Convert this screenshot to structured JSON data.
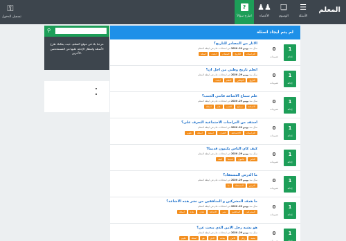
{
  "header": {
    "brand": "المعلم",
    "nav": [
      {
        "label": "الأسئلة",
        "icon": "list-icon"
      },
      {
        "label": "الوسوم",
        "icon": "tags-icon"
      },
      {
        "label": "الأعضاء",
        "icon": "users-icon"
      },
      {
        "label": "اطرح سؤالاً",
        "icon": "question-icon"
      }
    ],
    "login_label": "تسجيل الدخول"
  },
  "main": {
    "heading": "لم يتم ايجاد اسئلة",
    "questions": [
      {
        "title": "الاثار من المصادر للتاريخ؟",
        "votes": "1",
        "votes_label": "إجابة",
        "answers": "0",
        "answers_label": "تصويتات",
        "meta_prefix": "سأل منذ",
        "date": "يونيو 29، 2020",
        "meta_suffix": "في امتحانات عام في ابيطة المعلم",
        "tags": [
          "الدراسات",
          "التاريخ",
          "المصادر",
          "ابحث",
          "اسئلة"
        ]
      },
      {
        "title": "اتعلم تاريخ وطني من اجل ان؟",
        "votes": "1",
        "votes_label": "إجابة",
        "answers": "0",
        "answers_label": "تصويتات",
        "meta_prefix": "سأل منذ",
        "date": "يونيو 29، 2020",
        "meta_suffix": "في امتحانات عام في ابيطة المعلم",
        "tags": [
          "التاريخ",
          "الوطني",
          "التعلم",
          "ابحث"
        ]
      },
      {
        "title": "علم سماع الاشاعة فاتني الجنب؟",
        "votes": "1",
        "votes_label": "إجابة",
        "answers": "0",
        "answers_label": "تصويتات",
        "meta_prefix": "سأل منذ",
        "date": "يونيو 29، 2020",
        "meta_suffix": "في امتحانات عام في ابيطة المعلم",
        "tags": [
          "الاشاعة",
          "سماع",
          "الجنب",
          "علم",
          "اسئلة"
        ]
      },
      {
        "title": "استفد من الدراسات الاجتماعية التعرف على؟",
        "votes": "1",
        "votes_label": "إجابة",
        "answers": "0",
        "answers_label": "تصويتات",
        "meta_prefix": "سأل منذ",
        "date": "يونيو 29، 2020",
        "meta_suffix": "في امتحانات عام في ابيطة المعلم",
        "tags": [
          "الدراسات",
          "الاجتماعية",
          "التعرف",
          "استفد",
          "اسئلة",
          "علوم"
        ]
      },
      {
        "title": "كيف كان الناس يكتبون قديما؟",
        "votes": "1",
        "votes_label": "إجابة",
        "answers": "0",
        "answers_label": "تصويتات",
        "meta_prefix": "سأل منذ",
        "date": "يونيو 29، 2020",
        "meta_suffix": "في امتحانات عام في ابيطة المعلم",
        "tags": [
          "الناس",
          "يكتبون",
          "قديما",
          "كيف"
        ]
      },
      {
        "title": "ما الدرس المستفاد؟",
        "votes": "1",
        "votes_label": "إجابة",
        "answers": "0",
        "answers_label": "تصويتات",
        "meta_prefix": "سأل منذ",
        "date": "يونيو 29، 2020",
        "meta_suffix": "في امتحانات عام في ابيطة المعلم",
        "tags": [
          "الدرس",
          "المستفاد",
          "ما"
        ]
      },
      {
        "title": "ما هدف المشركين و المنافقين من نشر هذه الاشاعة؟",
        "votes": "1",
        "votes_label": "إجابة",
        "answers": "0",
        "answers_label": "تصويتات",
        "meta_prefix": "سأل منذ",
        "date": "يونيو 29، 2020",
        "meta_suffix": "في امتحانات عام في ابيطة المعلم",
        "tags": [
          "المشركين",
          "المنافقين",
          "نشر",
          "الاشاعة",
          "هدف",
          "هذه",
          "اسئلة"
        ]
      },
      {
        "title": "هو يشبه رجل الامن الذي يبحث عن؟",
        "votes": "1",
        "votes_label": "إجابة",
        "answers": "0",
        "answers_label": "تصويتات",
        "meta_prefix": "سأل منذ",
        "date": "يونيو 29، 2020",
        "meta_suffix": "في امتحانات عام في ابيطة المعلم",
        "tags": [
          "يشبه",
          "رجل",
          "الامن",
          "يبحث",
          "الذي",
          "هو",
          "اسئلة",
          "علوم"
        ]
      }
    ]
  },
  "sidebar": {
    "search_placeholder": "",
    "welcome": "مرحبا بك في موقع المعلم، حيث يمكنك طرح الأسئلة وانتظار الإجابة عليها من المستخدمين الآخرين."
  },
  "colors": {
    "topbar": "#3d454d",
    "accent_green": "#1d9e58",
    "heading_blue": "#1e90e8",
    "tag_orange": "#f38f1f",
    "title_blue": "#1a6ec9"
  }
}
